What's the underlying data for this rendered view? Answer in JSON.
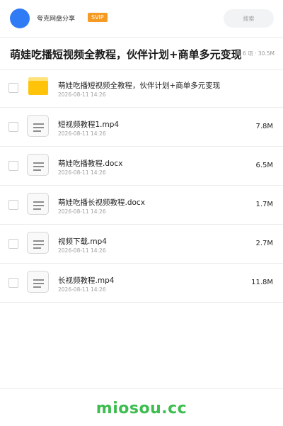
{
  "header": {
    "username": "夸克网盘分享",
    "badge": "SVIP",
    "search_placeholder": "搜索"
  },
  "share": {
    "title": "萌娃吃播短视频全教程，伙伴计划+商单多元变现",
    "meta": "6 项 · 30.5M"
  },
  "files": [
    {
      "type": "folder",
      "icon": "folder-icon",
      "name": "萌娃吃播短视频全教程，伙伴计划+商单多元变现",
      "date": "2026-08-11 14:26",
      "size": ""
    },
    {
      "type": "file",
      "icon": "file-icon",
      "name": "短视频教程1.mp4",
      "date": "2026-08-11 14:26",
      "size": "7.8M"
    },
    {
      "type": "file",
      "icon": "file-icon",
      "name": "萌娃吃播教程.docx",
      "date": "2026-08-11 14:26",
      "size": "6.5M"
    },
    {
      "type": "file",
      "icon": "file-icon",
      "name": "萌娃吃播长视频教程.docx",
      "date": "2026-08-11 14:26",
      "size": "1.7M"
    },
    {
      "type": "file",
      "icon": "file-icon",
      "name": "视频下载.mp4",
      "date": "2026-08-11 14:26",
      "size": "2.7M"
    },
    {
      "type": "file",
      "icon": "file-icon",
      "name": "长视频教程.mp4",
      "date": "2026-08-11 14:26",
      "size": "11.8M"
    }
  ],
  "footer": {
    "brand": "miosou.cc"
  },
  "colors": {
    "avatar": "#2f7bf5",
    "badge": "#f59a23",
    "folder": "#ffc409",
    "brand": "#3dbd4f"
  }
}
